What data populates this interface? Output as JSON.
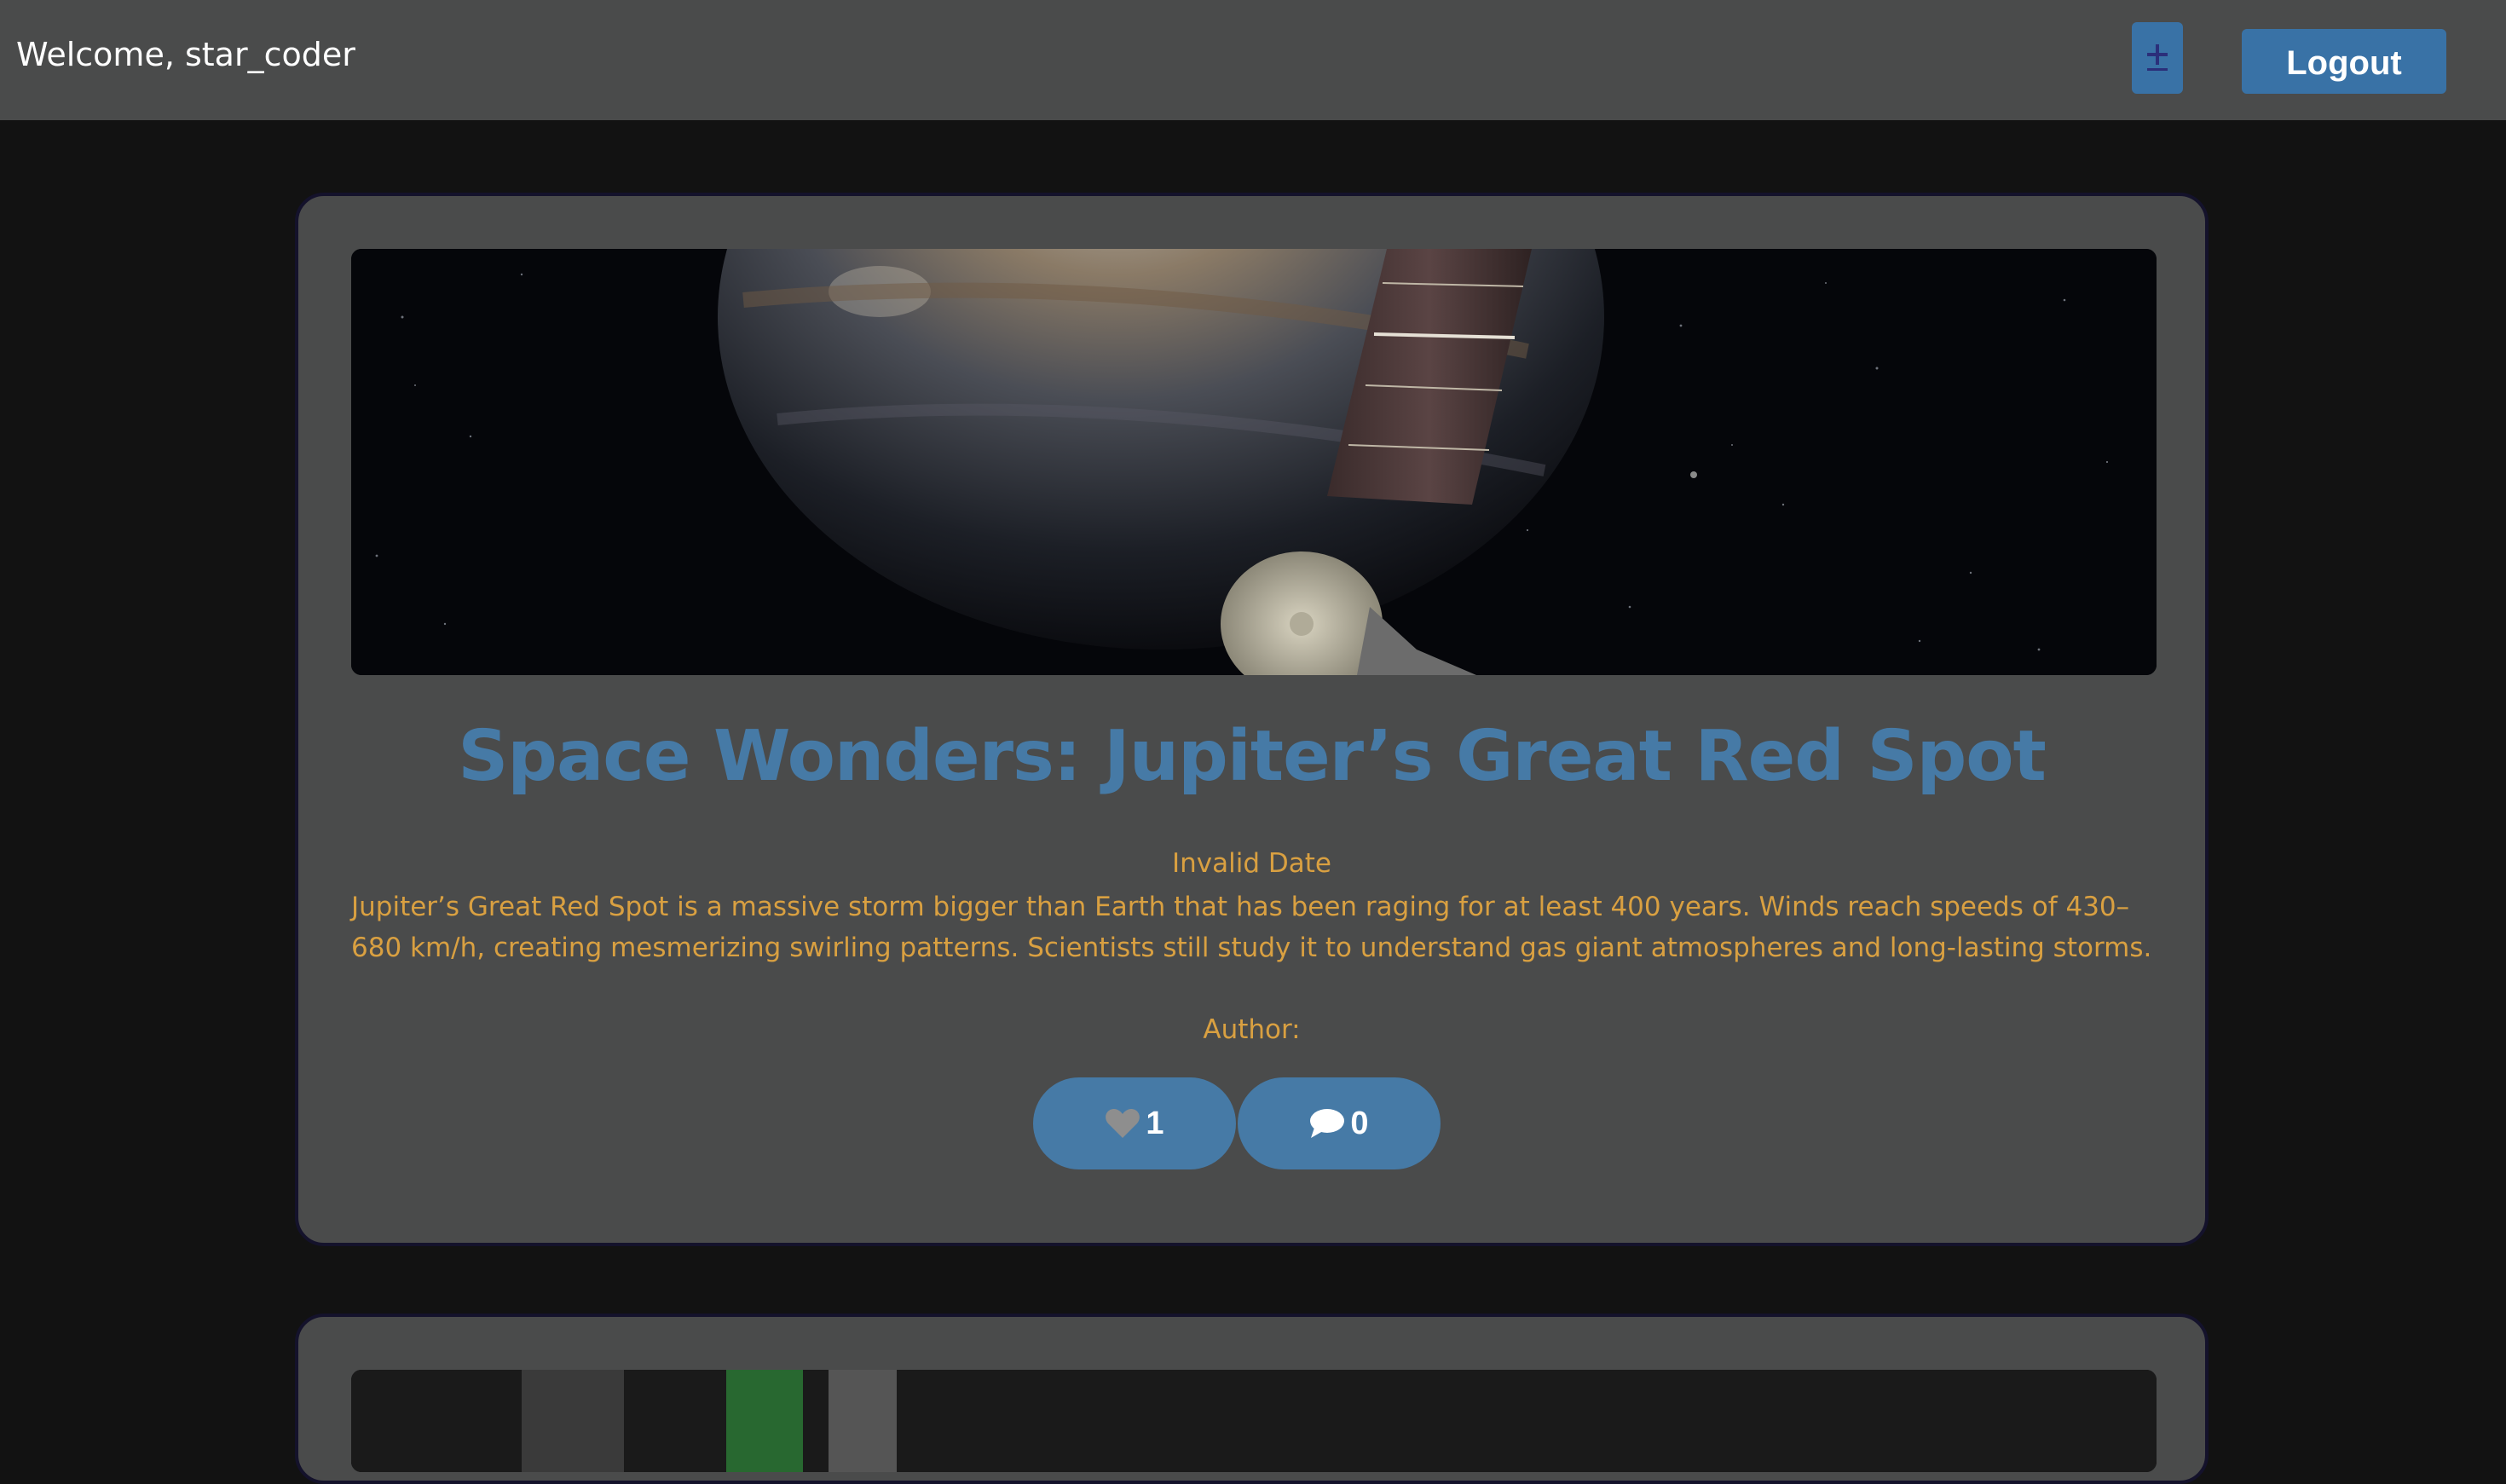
{
  "header": {
    "welcome_text": "Welcome, star_coder",
    "add_icon": "plus-minus-icon",
    "logout_label": "Logout"
  },
  "colors": {
    "topbar_bg": "#4a4b4b",
    "page_bg": "#121212",
    "card_bg": "#4a4b4b",
    "accent_blue": "#467aa6",
    "button_blue": "#3972a6",
    "text_gold": "#d9a041"
  },
  "posts": [
    {
      "image_alt": "Juno spacecraft near Jupiter",
      "title": "Space Wonders: Jupiter’s Great Red Spot",
      "date": "Invalid Date",
      "body": "Jupiter’s Great Red Spot is a massive storm bigger than Earth that has been raging for at least 400 years. Winds reach speeds of 430–680 km/h, creating mesmerizing swirling patterns. Scientists still study it to understand gas giant atmospheres and long-lasting storms.",
      "author": "Author:",
      "like_icon": "heart-icon",
      "like_count": "1",
      "comment_icon": "comment-icon",
      "comment_count": "0"
    }
  ]
}
